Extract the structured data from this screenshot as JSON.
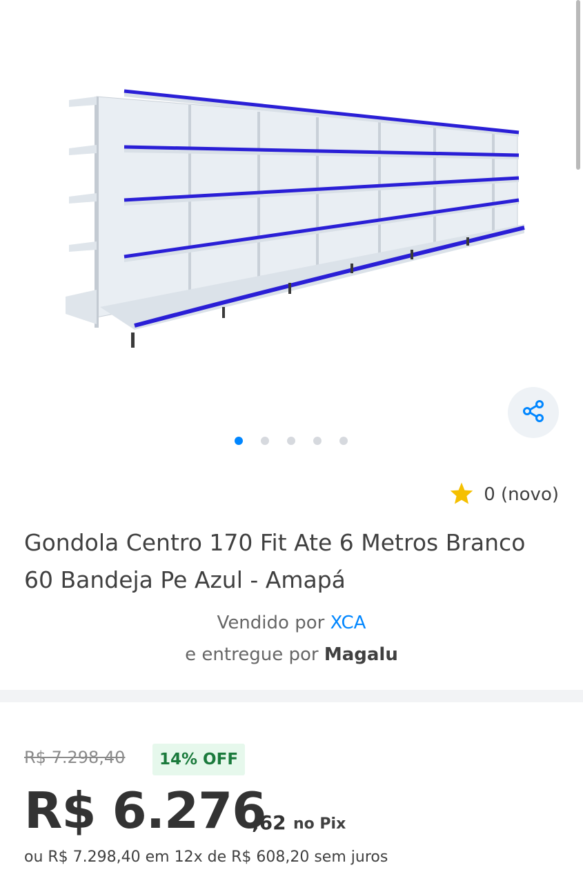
{
  "gallery": {
    "image_alt": "Gondola shelf product image",
    "dots_count": 5,
    "active_dot": 0
  },
  "rating": {
    "text": "0 (novo)"
  },
  "product": {
    "title": "Gondola Centro 170 Fit Ate 6 Metros Branco 60 Bandeja Pe Azul - Amapá"
  },
  "seller": {
    "sold_by_prefix": "Vendido por",
    "sold_by_name": "XCA",
    "delivered_by_prefix": "e entregue por",
    "delivered_by_name": "Magalu"
  },
  "price": {
    "old": "R$ 7.298,40",
    "discount_badge": "14% OFF",
    "main": "R$ 6.276",
    "cents": ",62",
    "method": "no Pix",
    "installments": "ou R$ 7.298,40 em 12x de R$ 608,20 sem juros"
  },
  "colors": {
    "accent": "#0086ff",
    "shelf_edge": "#2a1fd6",
    "badge_bg": "#e6f8ec",
    "badge_text": "#1a7a3c",
    "star": "#f5c000"
  },
  "icons": {
    "share": "share-icon",
    "star": "star-icon"
  }
}
